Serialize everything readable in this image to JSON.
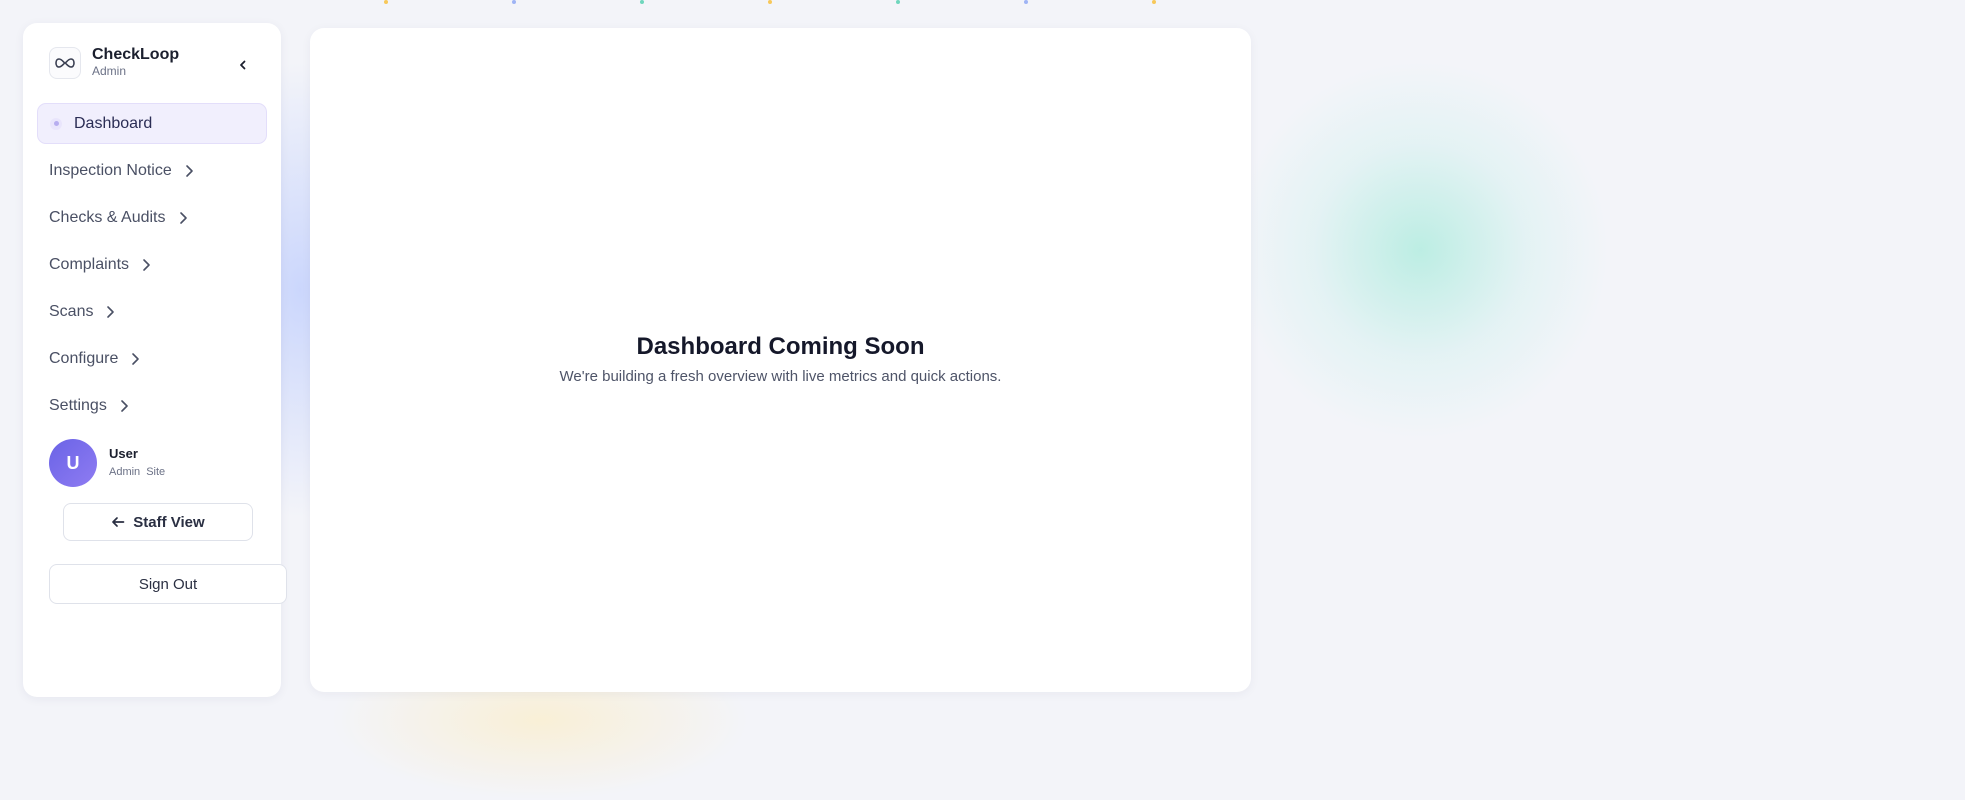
{
  "brand": {
    "name": "CheckLoop",
    "role": "Admin",
    "logo_icon": "infinity-loop-icon"
  },
  "sidebar": {
    "collapse_icon": "chevron-left-icon",
    "items": [
      {
        "label": "Dashboard",
        "active": true
      },
      {
        "label": "Inspection Notice",
        "icon": "chevron-right-icon"
      },
      {
        "label": "Checks & Audits",
        "icon": "chevron-right-icon"
      },
      {
        "label": "Complaints",
        "icon": "chevron-right-icon"
      },
      {
        "label": "Scans",
        "icon": "chevron-right-icon"
      },
      {
        "label": "Configure",
        "icon": "chevron-right-icon"
      },
      {
        "label": "Settings",
        "icon": "chevron-right-icon"
      }
    ]
  },
  "user": {
    "initial": "U",
    "name": "User",
    "role": "Admin",
    "site": "Site"
  },
  "actions": {
    "staff_view": "Staff View",
    "sign_out": "Sign Out"
  },
  "main": {
    "title": "Dashboard Coming Soon",
    "subtitle": "We're building a fresh overview with live metrics and quick actions."
  },
  "colors": {
    "accent": "#7c6cf0",
    "active_bg": "#f1effd"
  }
}
